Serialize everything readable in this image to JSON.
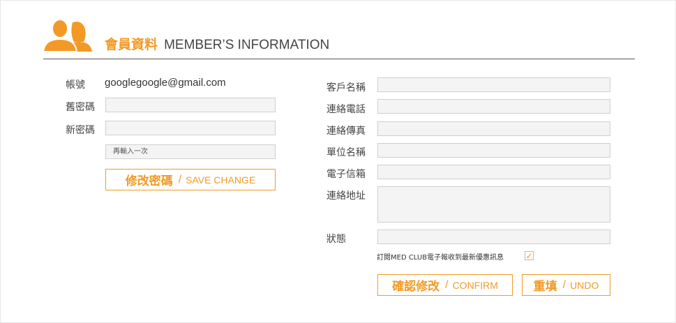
{
  "header": {
    "icon": "members-icon",
    "title_zh": "會員資料",
    "title_en": "MEMBER’S INFORMATION"
  },
  "colors": {
    "accent": "#f29a25",
    "field_bg": "#f4f4f4",
    "field_border": "#cfcfcf"
  },
  "left": {
    "account_label": "帳號",
    "account_value": "googlegoogle@gmail.com",
    "old_password_label": "舊密碼",
    "new_password_label": "新密碼",
    "confirm_placeholder": "再輸入一次",
    "save_button": {
      "zh": "修改密碼",
      "sep": "/",
      "en": "SAVE CHANGE"
    }
  },
  "right": {
    "customer_name_label": "客戶名稱",
    "phone_label": "連絡電話",
    "fax_label": "連絡傳真",
    "unit_name_label": "單位名稱",
    "email_label": "電子信箱",
    "address_label": "連絡地址",
    "status_label": "狀態",
    "subscribe_text": "訂閱MED CLUB電子報收到最新優惠訊息",
    "subscribe_checked": true,
    "confirm_button": {
      "zh": "確認修改",
      "sep": "/",
      "en": "CONFIRM"
    },
    "undo_button": {
      "zh": "重填",
      "sep": "/",
      "en": "UNDO"
    }
  }
}
